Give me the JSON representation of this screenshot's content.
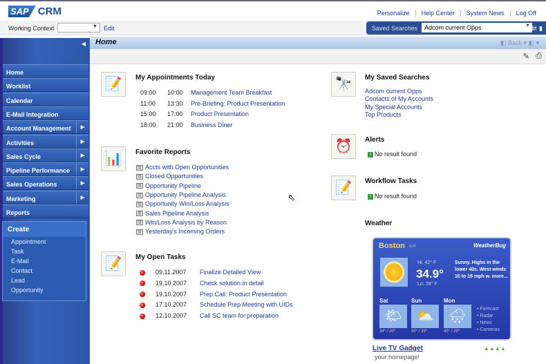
{
  "header": {
    "logo": "SAP CRM",
    "links": [
      "Personalize",
      "Help Center",
      "System News",
      "Log Off"
    ]
  },
  "context": {
    "label": "Working Context",
    "value": "",
    "edit": "Edit"
  },
  "saved_search_bar": {
    "label": "Saved Searches",
    "value": "Adcom current Opps",
    "go": "Go",
    "edit": "Edit"
  },
  "page": {
    "title": "Home",
    "back": "Back"
  },
  "sidebar": {
    "items": [
      {
        "label": "Home",
        "arrow": false
      },
      {
        "label": "Worklist",
        "arrow": false
      },
      {
        "label": "Calendar",
        "arrow": false
      },
      {
        "label": "E-Mail Integration",
        "arrow": false
      },
      {
        "label": "Account Management",
        "arrow": true
      },
      {
        "label": "Activities",
        "arrow": true
      },
      {
        "label": "Sales Cycle",
        "arrow": true
      },
      {
        "label": "Pipeline Performance",
        "arrow": true
      },
      {
        "label": "Sales Operations",
        "arrow": true
      },
      {
        "label": "Marketing",
        "arrow": true
      },
      {
        "label": "Reports",
        "arrow": false
      }
    ],
    "create": {
      "title": "Create",
      "items": [
        "Appointment",
        "Task",
        "E-Mail",
        "Contact",
        "Lead",
        "Opportunity"
      ]
    }
  },
  "appointments": {
    "title": "My Appointments Today",
    "rows": [
      {
        "start": "09:00",
        "end": "10:00",
        "desc": "Management Team Breakfast"
      },
      {
        "start": "11:00",
        "end": "13:30",
        "desc": "Pre-Briefing: Product Presentation"
      },
      {
        "start": "15:00",
        "end": "17:00",
        "desc": "Product Presentation"
      },
      {
        "start": "18:00",
        "end": "21:00",
        "desc": "Business Diner"
      }
    ]
  },
  "reports": {
    "title": "Favorite Reports",
    "items": [
      "Accts with Open Opportunities",
      "Closed Opportunities",
      "Opportunity Pipeline",
      "Opportunity Pipeline Analysis",
      "Opportunity Win/Loss Analysis",
      "Sales Pipeline Analysis",
      "Win/Loss Analysis by Reason",
      "Yesterday's Incoming Orders"
    ]
  },
  "tasks": {
    "title": "My Open Tasks",
    "rows": [
      {
        "date": "09.11.2007",
        "desc": "Finalize Detailed View"
      },
      {
        "date": "19.10.2007",
        "desc": "Check solution in detail"
      },
      {
        "date": "19.10.2007",
        "desc": "Prep Call: Product Presentation"
      },
      {
        "date": "17.10.2007",
        "desc": "Schedule Prep Meeting with UIDs"
      },
      {
        "date": "12.10.2007",
        "desc": "Call SC team for preparation"
      }
    ]
  },
  "saved_searches": {
    "title": "My Saved Searches",
    "items": [
      "Adcom current Opps",
      "Contacts of My Accounts",
      "My Special Accounts",
      "Top Products"
    ]
  },
  "alerts": {
    "title": "Alerts",
    "message": "No result found"
  },
  "workflow": {
    "title": "Workflow Tasks",
    "message": "No result found"
  },
  "weather": {
    "title": "Weather",
    "city": "Boston",
    "edit": "edit",
    "brand": "WeatherBug",
    "hi": "Hi: 42° F",
    "temp": "34.9°",
    "lo": "Lo: 28° F",
    "desc": "Sunny. Highs in the lower 40s. West winds 10 to 15 mph w. more...",
    "days": [
      {
        "name": "Sat",
        "range": "34° / 20°",
        "icon": "sun-cloud"
      },
      {
        "name": "Sun",
        "range": "35° / 33°",
        "icon": "cloudy"
      },
      {
        "name": "Mon",
        "range": "45° / 29°",
        "icon": "rain"
      }
    ],
    "links": [
      "• Forecast",
      "• Radar",
      "• News",
      "• Cameras"
    ],
    "gadget": "Live TV Gadget",
    "tagline": "your homepage!"
  }
}
